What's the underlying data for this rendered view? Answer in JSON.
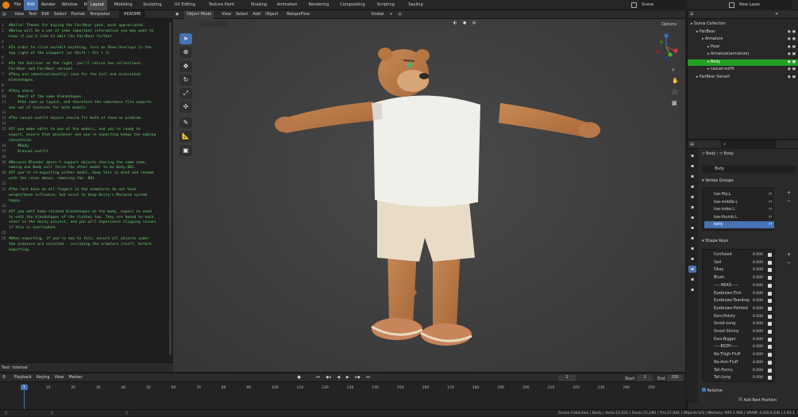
{
  "topmenu": [
    "File",
    "Edit",
    "Render",
    "Window",
    "Help"
  ],
  "workspaces": [
    "Layout",
    "Modeling",
    "Sculpting",
    "UV Editing",
    "Texture Paint",
    "Shading",
    "Animation",
    "Rendering",
    "Compositing",
    "Scripting",
    "Sayling"
  ],
  "scene": {
    "label": "Scene",
    "view_layer": "New Layer"
  },
  "text_editor": {
    "menu": [
      "View",
      "Text",
      "Edit",
      "Select",
      "Format",
      "Templates"
    ],
    "file": "README",
    "lines": [
      {
        "n": "1",
        "t": "#Hello! Thanks for buying the FairBear pack, much appreciated."
      },
      {
        "n": "2",
        "t": "#Below will be a set of some important information you may want to"
      },
      {
        "n": "",
        "t": "know if you'd like to edit the FairBear further."
      },
      {
        "n": "3",
        "t": ""
      },
      {
        "n": "4",
        "t": "#In order to click on/edit anything, turn on Show Overlays in the"
      },
      {
        "n": "",
        "t": "top right of the viewport (or Shift + Alt + Z)"
      },
      {
        "n": "5",
        "t": ""
      },
      {
        "n": "6",
        "t": "#In the Outliner on the right, you'll notice two collections,"
      },
      {
        "n": "",
        "t": "FairBear and FairBear variant."
      },
      {
        "n": "7",
        "t": "#They are identical(mostly) save for the tail and associated"
      },
      {
        "n": "",
        "t": "blendshapes."
      },
      {
        "n": "8",
        "t": ""
      },
      {
        "n": "9",
        "t": "#They share:"
      },
      {
        "n": "10",
        "t": "    #most of the same blendshapes."
      },
      {
        "n": "11",
        "t": "    #the same uv layout, and therefore the substance file exports"
      },
      {
        "n": "",
        "t": "one set of textures for both models"
      },
      {
        "n": "12",
        "t": ""
      },
      {
        "n": "13",
        "t": "#The casual-outfit object should fit both of them no problem."
      },
      {
        "n": "14",
        "t": ""
      },
      {
        "n": "15",
        "t": "#If you make edits to one of the models, and you're ready to"
      },
      {
        "n": "",
        "t": "export, ensure that whichever one you're exporting keeps the naming"
      },
      {
        "n": "",
        "t": "convention:"
      },
      {
        "n": "16",
        "t": "    #Body"
      },
      {
        "n": "17",
        "t": "    #casual-outfit"
      },
      {
        "n": "18",
        "t": ""
      },
      {
        "n": "19",
        "t": "#Because Blender doesn't support objects sharing the same name,"
      },
      {
        "n": "",
        "t": "naming one Body will force the other model to be Body.001."
      },
      {
        "n": "20",
        "t": "#If you're re-exporting either model, keep this in mind and rename"
      },
      {
        "n": "",
        "t": "with the rules above, removing the .001"
      },
      {
        "n": "21",
        "t": ""
      },
      {
        "n": "22",
        "t": "#The last bone on all fingers in the armatures do not have"
      },
      {
        "n": "",
        "t": "weight/bone influence, but exist to keep Unity's Mecanim system"
      },
      {
        "n": "",
        "t": "happy."
      },
      {
        "n": "23",
        "t": ""
      },
      {
        "n": "24",
        "t": "#If you edit body-related blendshapes on the body, expect to need"
      },
      {
        "n": "",
        "t": "to edit the blendshapes of the clothes too. They are bound to each"
      },
      {
        "n": "",
        "t": "other in the Unity project, and you will experience clipping issues"
      },
      {
        "n": "",
        "t": "if this is overlooked."
      },
      {
        "n": "25",
        "t": ""
      },
      {
        "n": "26",
        "t": "#When exporting, if you're new to this, ensure all objects under"
      },
      {
        "n": "",
        "t": "the armature are selected - including the armature itself, before"
      },
      {
        "n": "",
        "t": "exporting."
      }
    ],
    "footer": "Text: Internal"
  },
  "viewport": {
    "mode": "Object Mode",
    "menu": [
      "View",
      "Select",
      "Add",
      "Object"
    ],
    "retopo": "RetopoFlow",
    "transform": "Global",
    "options": "Options"
  },
  "outliner": {
    "items": [
      {
        "label": "Scene Collection",
        "indent": 0
      },
      {
        "label": "FairBear",
        "indent": 1
      },
      {
        "label": "Armature",
        "indent": 2
      },
      {
        "label": "Pose",
        "indent": 3
      },
      {
        "label": "Armature(armature)",
        "indent": 3
      },
      {
        "label": "Body",
        "indent": 3,
        "highlight": true
      },
      {
        "label": "casual-outfit",
        "indent": 3
      },
      {
        "label": "FairBear Variant",
        "indent": 1
      }
    ]
  },
  "properties": {
    "breadcrumb_obj": "Body",
    "breadcrumb_data": "Body",
    "mesh_name": "Body",
    "vertex_groups_title": "Vertex Groups",
    "vertex_groups": [
      {
        "label": "toe-Hip.L"
      },
      {
        "label": "toe-middle.L"
      },
      {
        "label": "toe-index.L"
      },
      {
        "label": "toe-thumb.L"
      },
      {
        "label": "belly",
        "selected": true
      }
    ],
    "shape_keys_title": "Shape Keys",
    "shape_keys": [
      {
        "label": "Confused",
        "value": "0.000"
      },
      {
        "label": "Sad",
        "value": "0.000"
      },
      {
        "label": "Okay",
        "value": "0.000"
      },
      {
        "label": "Blush",
        "value": "0.000"
      },
      {
        "label": "-----HEAD-----",
        "value": "0.000"
      },
      {
        "label": "Eyebrows-Thin",
        "value": "0.000"
      },
      {
        "label": "Eyebrows-Teardrop",
        "value": "0.000"
      },
      {
        "label": "Eyebrows-Pointed",
        "value": "0.000"
      },
      {
        "label": "Ears-Pointy",
        "value": "0.000"
      },
      {
        "label": "Snoot-Long",
        "value": "0.000"
      },
      {
        "label": "Snoot-Skinny",
        "value": "0.000"
      },
      {
        "label": "Ears-Bigger",
        "value": "0.000"
      },
      {
        "label": "-----BODY-----",
        "value": "0.000"
      },
      {
        "label": "No-Thigh-Fluff",
        "value": "0.000"
      },
      {
        "label": "No-Arm-Fluff",
        "value": "0.000"
      },
      {
        "label": "Tail-Fonny",
        "value": "0.000"
      },
      {
        "label": "Tail-Long",
        "value": "0.000"
      }
    ],
    "relative": "Relative",
    "add_rest": "Add Rest Position"
  },
  "timeline": {
    "menu": [
      "Playback",
      "Keying",
      "View",
      "Marker"
    ],
    "current_frame": "1",
    "start_label": "Start",
    "start": "1",
    "end_label": "End",
    "end": "250",
    "ticks": [
      "0",
      "10",
      "20",
      "30",
      "40",
      "50",
      "60",
      "70",
      "80",
      "90",
      "100",
      "110",
      "120",
      "130",
      "140",
      "150",
      "160",
      "170",
      "180",
      "190",
      "200",
      "210",
      "220",
      "230",
      "240",
      "250"
    ]
  },
  "status": "Scene Collection | Body | Verts:15,631 | Faces:15,280 | Tris:37,942 | Objects:1/3 | Memory: 695.1 MiB | VRAM: 4.5/8.0 GiB | 2.93.1",
  "colors": {
    "accent": "#4772b3",
    "outliner_highlight": "#23a023",
    "code": "#6fcf6f"
  }
}
